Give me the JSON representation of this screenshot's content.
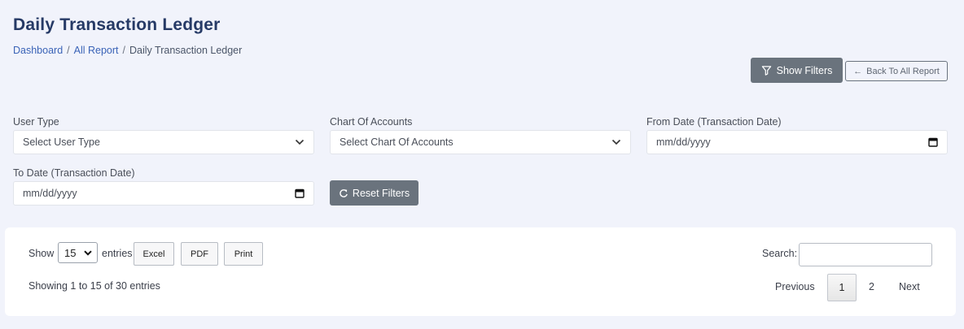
{
  "header": {
    "title": "Daily Transaction Ledger",
    "breadcrumb": [
      "Dashboard",
      "All Report",
      "Daily Transaction Ledger"
    ]
  },
  "actions": {
    "show_filters": "Show Filters",
    "back": "Back To All Report"
  },
  "filters": {
    "user_type": {
      "label": "User Type",
      "value": "Select User Type"
    },
    "chart_of_accounts": {
      "label": "Chart Of Accounts",
      "value": "Select Chart Of Accounts"
    },
    "from_date": {
      "label": "From Date (Transaction Date)",
      "placeholder": "mm/dd/yyyy"
    },
    "to_date": {
      "label": "To Date (Transaction Date)",
      "placeholder": "mm/dd/yyyy"
    },
    "reset": "Reset Filters"
  },
  "table_controls": {
    "show": "Show",
    "length_value": "15",
    "entries": "entries",
    "buttons": [
      "Excel",
      "PDF",
      "Print"
    ],
    "info": "Showing 1 to 15 of 30 entries",
    "search_label": "Search:",
    "pagination": {
      "previous": "Previous",
      "pages": [
        "1",
        "2"
      ],
      "next": "Next",
      "active": "1"
    }
  },
  "colors": {
    "title": "#263a66",
    "link": "#3a63b7",
    "button": "#6a737d",
    "background": "#f1f3fb"
  }
}
